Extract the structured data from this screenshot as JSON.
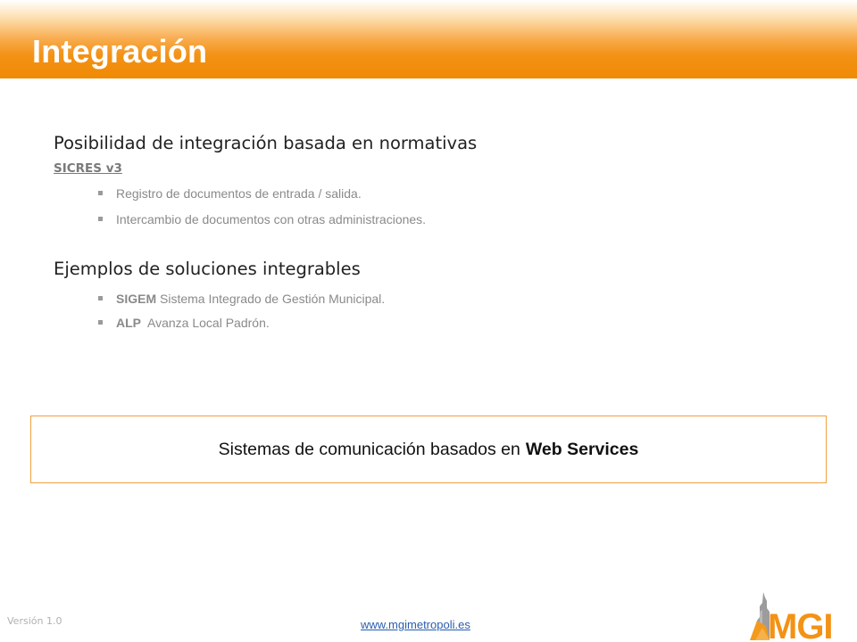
{
  "header": {
    "title": "Integración"
  },
  "section1": {
    "heading": "Posibilidad de integración basada en normativas",
    "sub_link": "SICRES v3",
    "bullets": [
      "Registro de documentos de entrada / salida.",
      "Intercambio de documentos con otras administraciones."
    ]
  },
  "section2": {
    "heading": "Ejemplos de soluciones integrables",
    "bullets": [
      {
        "bold": "SIGEM",
        "text": "Sistema Integrado de Gestión Municipal."
      },
      {
        "bold": "ALP",
        "text": "Avanza Local Padrón."
      }
    ]
  },
  "callout": {
    "text": "Sistemas de comunicación basados en",
    "bold": "Web Services"
  },
  "footer": {
    "version": "Versión 1.0",
    "website": "www.mgimetropoli.es",
    "logo_text": "MGI"
  },
  "colors": {
    "accent_orange": "#f39215",
    "link_blue": "#2a5db0"
  }
}
